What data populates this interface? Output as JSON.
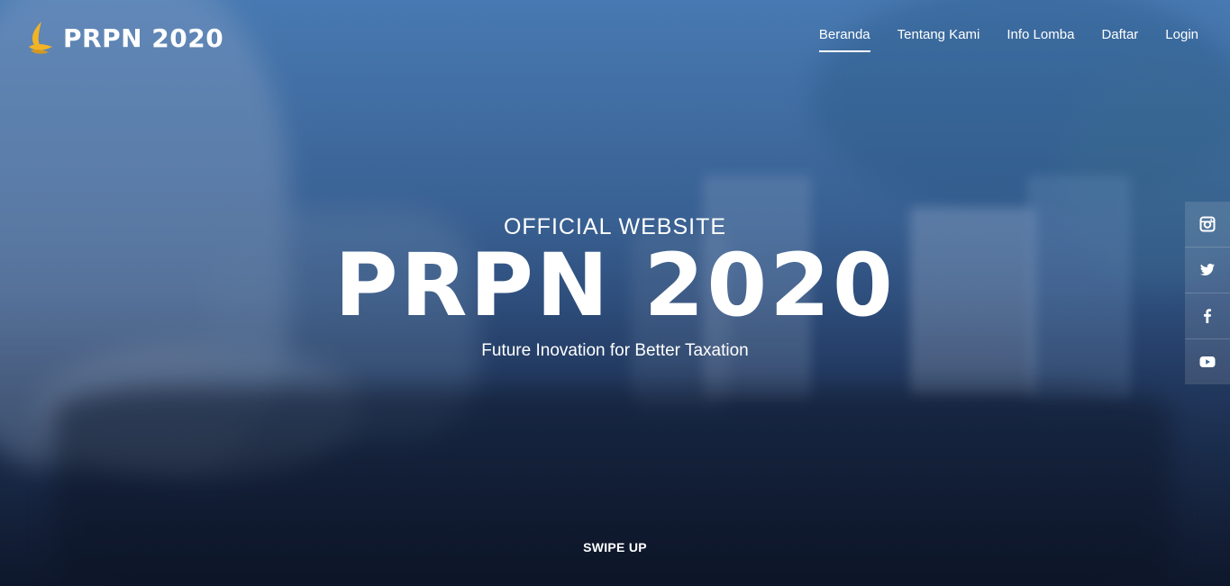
{
  "brand": {
    "name": "PRPN 2020",
    "logo_icon": "flame-leaf-icon",
    "logo_color": "#f2b424"
  },
  "nav": {
    "items": [
      {
        "label": "Beranda",
        "active": true
      },
      {
        "label": "Tentang Kami",
        "active": false
      },
      {
        "label": "Info Lomba",
        "active": false
      },
      {
        "label": "Daftar",
        "active": false
      },
      {
        "label": "Login",
        "active": false
      }
    ]
  },
  "hero": {
    "subtitle": "OFFICIAL WEBSITE",
    "title": "PRPN 2020",
    "tagline": "Future Inovation for Better Taxation",
    "swipe_label": "SWIPE UP"
  },
  "social": {
    "items": [
      {
        "icon": "instagram-icon"
      },
      {
        "icon": "twitter-icon"
      },
      {
        "icon": "facebook-icon"
      },
      {
        "icon": "youtube-icon"
      }
    ]
  },
  "colors": {
    "accent": "#f2b424",
    "text": "#ffffff",
    "overlay": "#3f6797"
  }
}
